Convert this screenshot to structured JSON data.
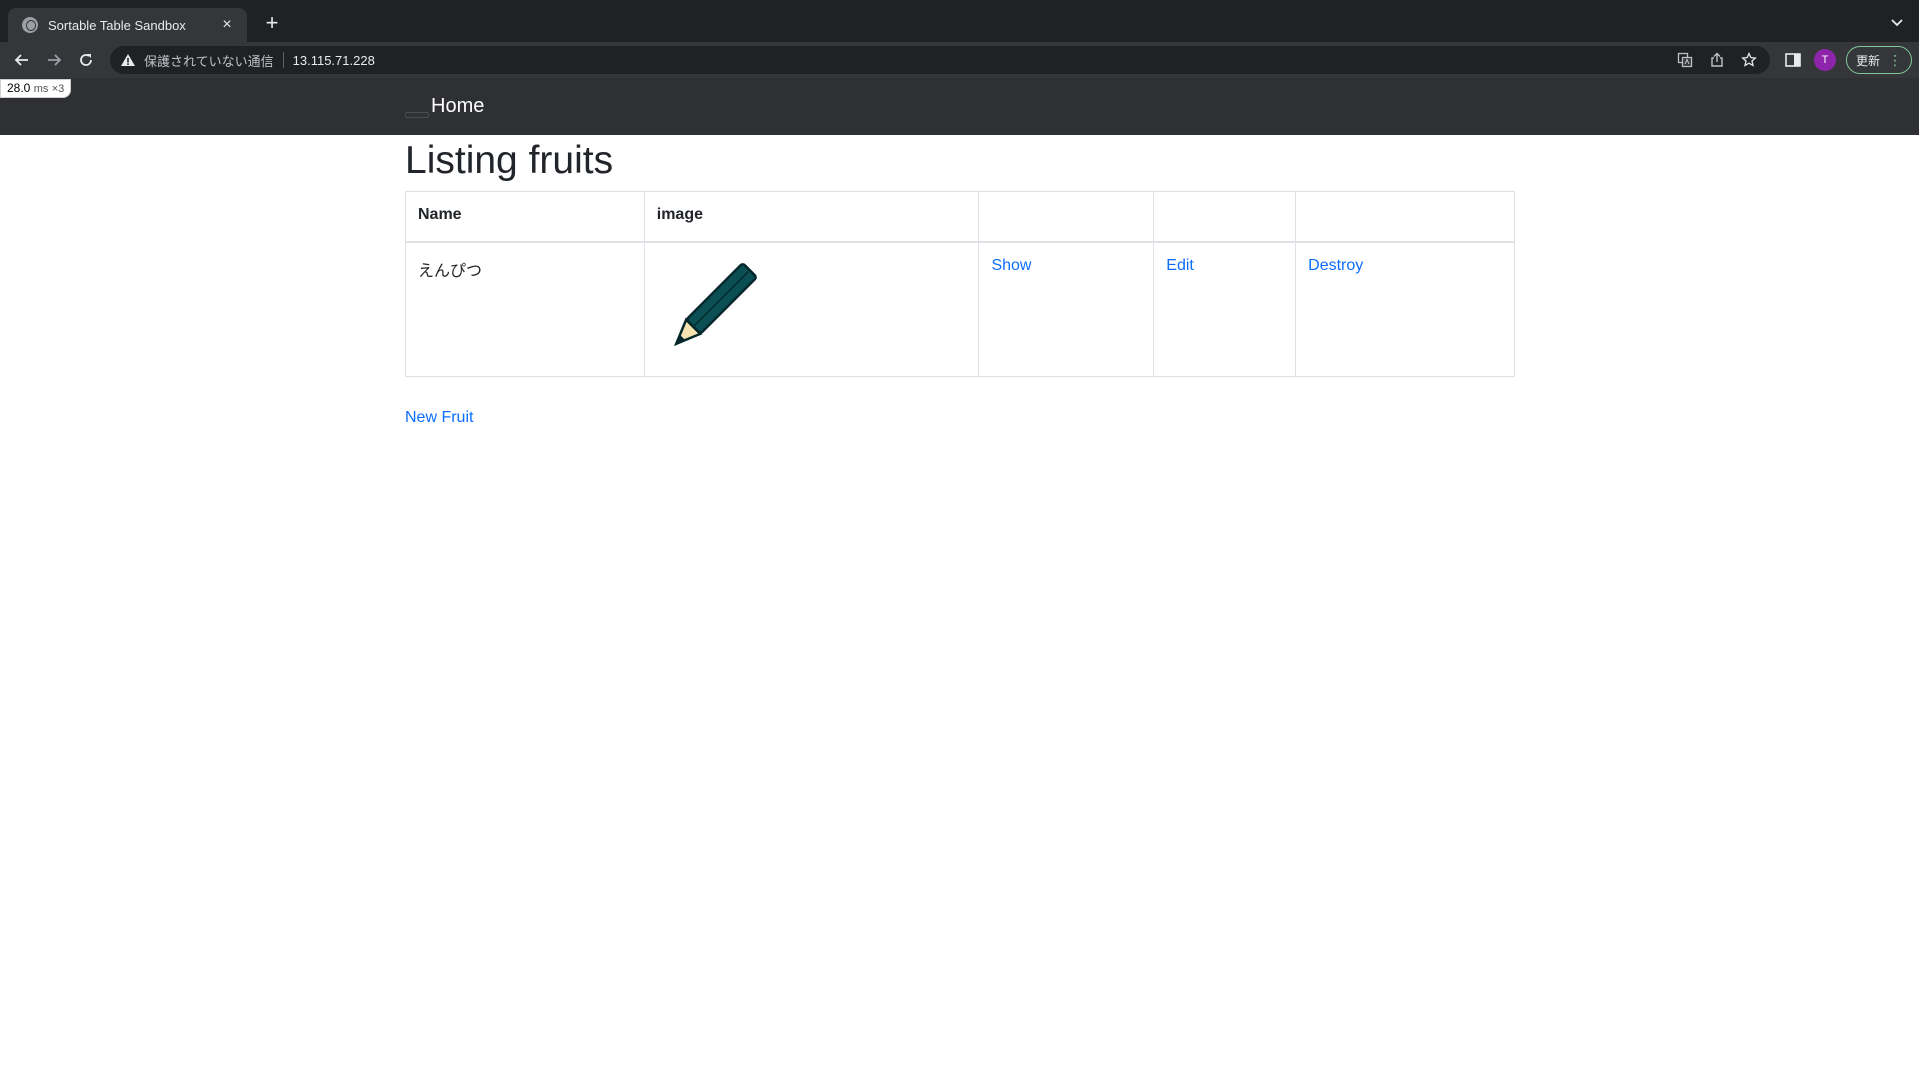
{
  "browser": {
    "tab_title": "Sortable Table Sandbox",
    "tab_close": "×",
    "new_tab": "+",
    "security_label": "保護されていない通信",
    "url": "13.115.71.228",
    "avatar_letter": "T",
    "update_label": "更新",
    "update_menu": "⋮"
  },
  "perf_badge": {
    "value": "28.0",
    "unit": "ms",
    "count": "×3"
  },
  "navbar": {
    "brand": "Home"
  },
  "page": {
    "title": "Listing fruits",
    "new_link": "New Fruit"
  },
  "table": {
    "headers": [
      "Name",
      "image",
      "",
      "",
      ""
    ],
    "rows": [
      {
        "name": "えんぴつ",
        "image_icon": "pencil-icon",
        "show": "Show",
        "edit": "Edit",
        "destroy": "Destroy"
      }
    ]
  },
  "colors": {
    "navbar_bg": "#2e3033",
    "link": "#0d6efd",
    "pencil_body": "#0b4f54"
  }
}
